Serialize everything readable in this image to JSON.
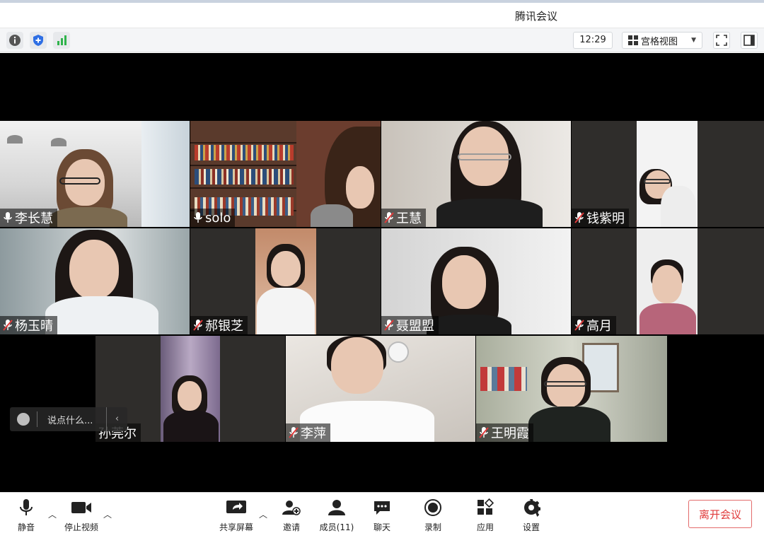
{
  "window": {
    "title": "腾讯会议"
  },
  "toolbar": {
    "info_icon": "info-icon",
    "security_icon": "shield-icon",
    "signal_icon": "signal-icon",
    "clock": "12:29",
    "view_label": "宫格视图",
    "accent": "#2f6fe4",
    "signal_color": "#2fb34b"
  },
  "participants": [
    {
      "name": "李长慧",
      "muted": false
    },
    {
      "name": "solo",
      "muted": false
    },
    {
      "name": "王慧",
      "muted": true
    },
    {
      "name": "钱紫明",
      "muted": true
    },
    {
      "name": "杨玉晴",
      "muted": true
    },
    {
      "name": "郝银芝",
      "muted": true
    },
    {
      "name": "聂盟盟",
      "muted": true
    },
    {
      "name": "高月",
      "muted": true
    },
    {
      "name": "孙莞尔",
      "muted": true
    },
    {
      "name": "李萍",
      "muted": true
    },
    {
      "name": "王明霞",
      "muted": true
    }
  ],
  "chat": {
    "placeholder": "说点什么..."
  },
  "bottom": {
    "mute": "静音",
    "stop_video": "停止视频",
    "share": "共享屏幕",
    "invite": "邀请",
    "members": "成员(11)",
    "chat": "聊天",
    "record": "录制",
    "apps": "应用",
    "settings": "设置",
    "leave": "离开会议",
    "leave_color": "#e03a3a"
  }
}
